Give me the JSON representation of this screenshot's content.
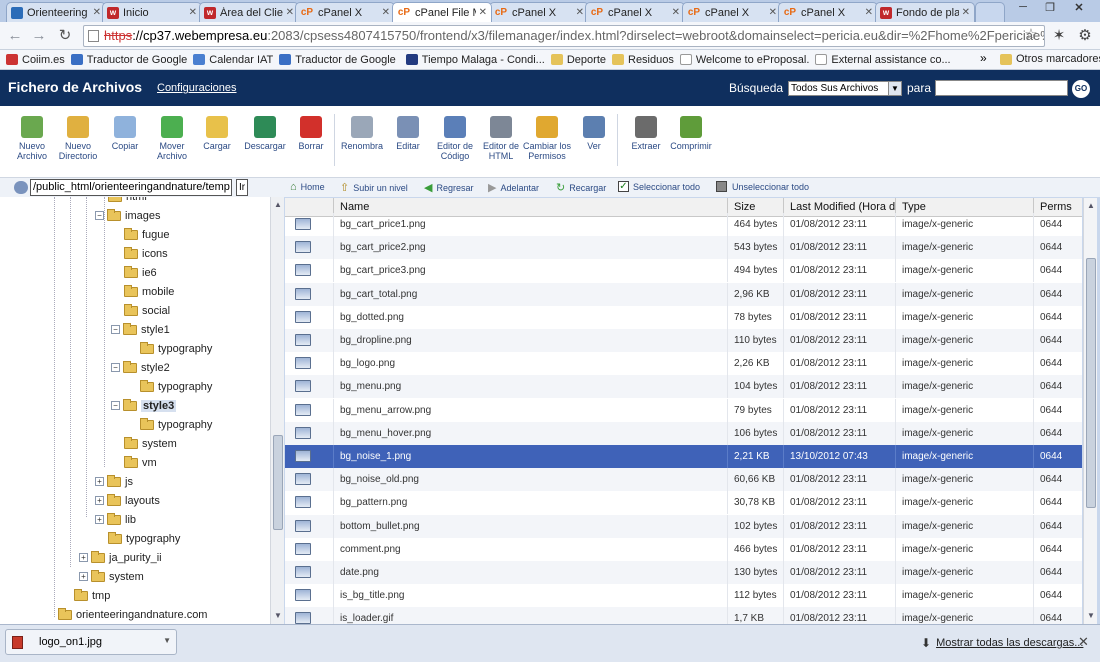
{
  "browser": {
    "tabs": [
      {
        "label": "Orienteering",
        "icon": "joomla"
      },
      {
        "label": "Inicio",
        "icon": "webempresa"
      },
      {
        "label": "Área del Clie",
        "icon": "webempresa"
      },
      {
        "label": "cPanel X",
        "icon": "cpanel"
      },
      {
        "label": "cPanel File M",
        "icon": "cpanel",
        "active": true
      },
      {
        "label": "cPanel X",
        "icon": "cpanel"
      },
      {
        "label": "cPanel X",
        "icon": "cpanel"
      },
      {
        "label": "cPanel X",
        "icon": "cpanel"
      },
      {
        "label": "cPanel X",
        "icon": "cpanel"
      },
      {
        "label": "Fondo de pla",
        "icon": "webempresa"
      }
    ],
    "url_scheme": "https",
    "url_domain": "://cp37.webempresa.eu",
    "url_rest": ":2083/cpsess4807415750/frontend/x3/filemanager/index.html?dirselect=webroot&domainselect=pericia.eu&dir=%2Fhome%2Fpericiae%2Fpublic",
    "bookmarks": [
      "Coiim.es",
      "Traductor de Google",
      "Calendar IAT",
      "Traductor de Google",
      "Tiempo Malaga - Condi...",
      "Deporte",
      "Residuos",
      "Welcome to eProposal.",
      "External assistance co..."
    ],
    "bookmarks_more": "»",
    "other_bookmarks": "Otros marcadores"
  },
  "app": {
    "title": "Fichero de Archivos",
    "settings_link": "Configuraciones",
    "search_label": "Búsqueda",
    "search_scope": "Todos Sus Archivos",
    "search_for": "para",
    "search_value": "",
    "go_label": "GO"
  },
  "toolbar": [
    {
      "label": "Nuevo Archivo",
      "icon": "new-file-icon",
      "color": "#6aa84f"
    },
    {
      "label": "Nuevo Directorio",
      "icon": "new-folder-icon",
      "color": "#e0b040"
    },
    {
      "label": "Copiar",
      "icon": "copy-icon",
      "color": "#8fb2dc"
    },
    {
      "label": "Mover Archivo",
      "icon": "move-icon",
      "color": "#4caf50"
    },
    {
      "label": "Cargar",
      "icon": "upload-icon",
      "color": "#e8c14a"
    },
    {
      "label": "Descargar",
      "icon": "download-icon",
      "color": "#2e8b57"
    },
    {
      "label": "Borrar",
      "icon": "delete-icon",
      "color": "#d2302b"
    },
    {
      "label": "Renombra",
      "icon": "rename-icon",
      "color": "#9aa7b8"
    },
    {
      "label": "Editar",
      "icon": "edit-icon",
      "color": "#7a90b5"
    },
    {
      "label": "Editor de Código",
      "icon": "code-editor-icon",
      "color": "#5b7fb8"
    },
    {
      "label": "Editor de HTML",
      "icon": "html-editor-icon",
      "color": "#7d8796"
    },
    {
      "label": "Cambiar los Permisos",
      "icon": "permissions-icon",
      "color": "#e0a830"
    },
    {
      "label": "Ver",
      "icon": "view-icon",
      "color": "#5c7fb0"
    },
    {
      "label": "Extraer",
      "icon": "extract-icon",
      "color": "#6b6b6b"
    },
    {
      "label": "Comprimir",
      "icon": "compress-icon",
      "color": "#5f9c3a"
    }
  ],
  "nav": {
    "path": "/public_html/orienteeringandnature/temp",
    "path_go": "Ir",
    "home": "Home",
    "up": "Subir un nivel",
    "back": "Regresar",
    "forward": "Adelantar",
    "reload": "Recargar",
    "select_all": "Seleccionar todo",
    "unselect_all": "Unseleccionar todo"
  },
  "tree": [
    {
      "label": "html",
      "level": 3,
      "expander": ""
    },
    {
      "label": "images",
      "level": 3,
      "expander": "−",
      "open": true
    },
    {
      "label": "fugue",
      "level": 4,
      "expander": ""
    },
    {
      "label": "icons",
      "level": 4,
      "expander": ""
    },
    {
      "label": "ie6",
      "level": 4,
      "expander": ""
    },
    {
      "label": "mobile",
      "level": 4,
      "expander": ""
    },
    {
      "label": "social",
      "level": 4,
      "expander": ""
    },
    {
      "label": "style1",
      "level": 4,
      "expander": "−",
      "open": true
    },
    {
      "label": "typography",
      "level": 5,
      "expander": ""
    },
    {
      "label": "style2",
      "level": 4,
      "expander": "−",
      "open": true
    },
    {
      "label": "typography",
      "level": 5,
      "expander": ""
    },
    {
      "label": "style3",
      "level": 4,
      "expander": "−",
      "open": true,
      "selected": true
    },
    {
      "label": "typography",
      "level": 5,
      "expander": ""
    },
    {
      "label": "system",
      "level": 4,
      "expander": ""
    },
    {
      "label": "vm",
      "level": 4,
      "expander": ""
    },
    {
      "label": "js",
      "level": 3,
      "expander": "+"
    },
    {
      "label": "layouts",
      "level": 3,
      "expander": "+"
    },
    {
      "label": "lib",
      "level": 3,
      "expander": "+"
    },
    {
      "label": "typography",
      "level": 3,
      "expander": ""
    },
    {
      "label": "ja_purity_ii",
      "level": 2,
      "expander": "+"
    },
    {
      "label": "system",
      "level": 2,
      "expander": "+"
    },
    {
      "label": "tmp",
      "level": 1,
      "expander": ""
    },
    {
      "label": "orienteeringandnature.com",
      "level": 0,
      "expander": ""
    }
  ],
  "table": {
    "columns": [
      "Name",
      "Size",
      "Last Modified (Hora de ve",
      "Type",
      "Perms"
    ],
    "rows": [
      {
        "name": "bg_cart_price1.png",
        "size": "464 bytes",
        "modified": "01/08/2012 23:11",
        "type": "image/x-generic",
        "perms": "0644"
      },
      {
        "name": "bg_cart_price2.png",
        "size": "543 bytes",
        "modified": "01/08/2012 23:11",
        "type": "image/x-generic",
        "perms": "0644"
      },
      {
        "name": "bg_cart_price3.png",
        "size": "494 bytes",
        "modified": "01/08/2012 23:11",
        "type": "image/x-generic",
        "perms": "0644"
      },
      {
        "name": "bg_cart_total.png",
        "size": "2,96 KB",
        "modified": "01/08/2012 23:11",
        "type": "image/x-generic",
        "perms": "0644"
      },
      {
        "name": "bg_dotted.png",
        "size": "78 bytes",
        "modified": "01/08/2012 23:11",
        "type": "image/x-generic",
        "perms": "0644"
      },
      {
        "name": "bg_dropline.png",
        "size": "110 bytes",
        "modified": "01/08/2012 23:11",
        "type": "image/x-generic",
        "perms": "0644"
      },
      {
        "name": "bg_logo.png",
        "size": "2,26 KB",
        "modified": "01/08/2012 23:11",
        "type": "image/x-generic",
        "perms": "0644"
      },
      {
        "name": "bg_menu.png",
        "size": "104 bytes",
        "modified": "01/08/2012 23:11",
        "type": "image/x-generic",
        "perms": "0644"
      },
      {
        "name": "bg_menu_arrow.png",
        "size": "79 bytes",
        "modified": "01/08/2012 23:11",
        "type": "image/x-generic",
        "perms": "0644"
      },
      {
        "name": "bg_menu_hover.png",
        "size": "106 bytes",
        "modified": "01/08/2012 23:11",
        "type": "image/x-generic",
        "perms": "0644"
      },
      {
        "name": "bg_noise_1.png",
        "size": "2,21 KB",
        "modified": "13/10/2012 07:43",
        "type": "image/x-generic",
        "perms": "0644",
        "selected": true
      },
      {
        "name": "bg_noise_old.png",
        "size": "60,66 KB",
        "modified": "01/08/2012 23:11",
        "type": "image/x-generic",
        "perms": "0644"
      },
      {
        "name": "bg_pattern.png",
        "size": "30,78 KB",
        "modified": "01/08/2012 23:11",
        "type": "image/x-generic",
        "perms": "0644"
      },
      {
        "name": "bottom_bullet.png",
        "size": "102 bytes",
        "modified": "01/08/2012 23:11",
        "type": "image/x-generic",
        "perms": "0644"
      },
      {
        "name": "comment.png",
        "size": "466 bytes",
        "modified": "01/08/2012 23:11",
        "type": "image/x-generic",
        "perms": "0644"
      },
      {
        "name": "date.png",
        "size": "130 bytes",
        "modified": "01/08/2012 23:11",
        "type": "image/x-generic",
        "perms": "0644"
      },
      {
        "name": "is_bg_title.png",
        "size": "112 bytes",
        "modified": "01/08/2012 23:11",
        "type": "image/x-generic",
        "perms": "0644"
      },
      {
        "name": "is_loader.gif",
        "size": "1,7 KB",
        "modified": "01/08/2012 23:11",
        "type": "image/x-generic",
        "perms": "0644"
      }
    ]
  },
  "download": {
    "file": "logo_on1.jpg",
    "show_all": "Mostrar todas las descargas..."
  },
  "colors": {
    "header_bg": "#0f2f5e",
    "selected_row": "#3f62b8",
    "toolbar_text": "#2b4a84"
  }
}
